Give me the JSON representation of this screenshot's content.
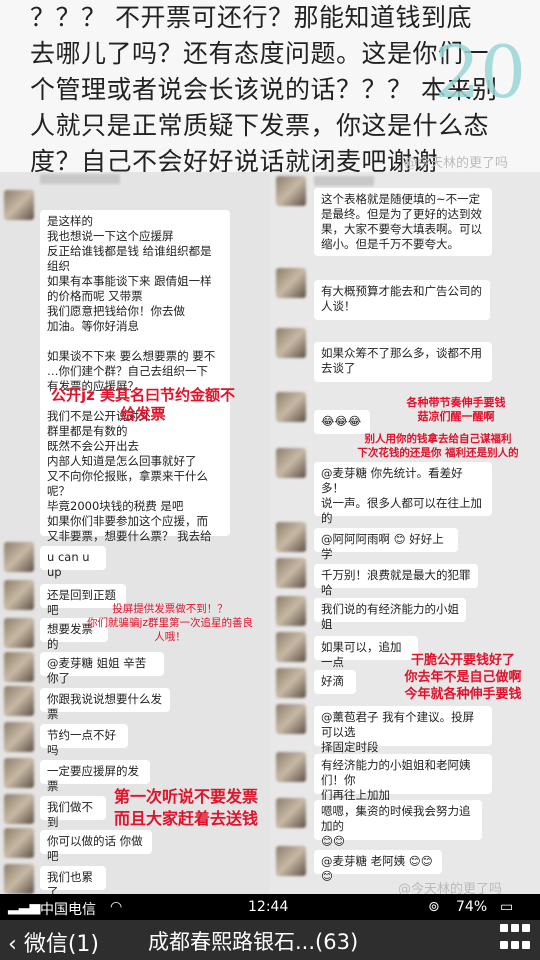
{
  "header": {
    "line1": "？？？ 不开票可还行？那能知道钱到底",
    "line2": "去哪儿了吗？还有态度问题。这是你们一",
    "line3": "个管理或者说会长该说的话？？？ 本来别",
    "line4": "人就只是正常质疑下发票，你这是什么态",
    "line5": "度？自己不会好好说话就闭麦吧谢谢",
    "page_number": "20",
    "watermark": "@今天林的更了吗"
  },
  "left_messages": [
    "是这样的\n我也想说一下这个应援屏\n反正给谁钱都是钱 给谁组织都是\n组织\n如果有本事能谈下来 跟倩姐一样\n的价格而呢 又带票\n我们愿意把钱给你！你去做\n加油。等你好消息\n\n如果谈不下来 要么想要票的 要不\n…你们建个群？自己去组织一下\n有发票的应援屏？\n\n我们不是公开说对外\n群里都是有数的\n既然不会公开出去\n内部人知道是怎么回事就好了\n又不向你伦报账，拿票来干什么\n呢？\n毕竟2000块钱的税费 是吧\n如果你们非要参加这个应援，而\n又非要票，想要什么票？ 我去给",
    "u can u up",
    "还是回到正题吧",
    "想要发票的",
    "@麦芽糖 姐姐 辛苦你了",
    "你跟我说说想要什么发票",
    "节约一点不好吗",
    "一定要应援屏的发票",
    "我们做不到",
    "你可以做的话 你做吧",
    "我们也累了"
  ],
  "right_messages": [
    "这个表格就是随便填的~不一定\n是最终。但是为了更好的达到效\n果，大家不要夸大填表啊。可以\n缩小。但是千万不要夸大。",
    "有大概预算才能去和广告公司的\n人谈！",
    "如果众筹不了那么多，谈都不用\n去谈了",
    "😂😂😂",
    "@麦芽糖 你先统计。看差好多！\n说一声。很多人都可以在往上加\n的",
    "@阿阿阿雨啊 😊 好好上学",
    "千万别！浪费就是最大的犯罪哈",
    "我们说的有经济能力的小姐姐",
    "如果可以，追加一点",
    "好滴",
    "@薰苞君子 我有个建议。投屏可以选\n择固定时段",
    "有经济能力的小姐姐和老阿姨们！你\n们再往上加加",
    "嗯嗯，集资的时候我会努力追加的\n😊😊",
    "@麦芽糖 老阿姨 😊😊😊"
  ],
  "annotations": {
    "left_1": "公开jz 美其名曰节约金额不\n给发票",
    "left_2": "投屏提供发票做不到！？\n你们就骗骗jz群里第一次追星的善良\n人哦！",
    "left_3": "第一次听说不要发票\n而且大家赶着去送钱",
    "right_1": "各种带节奏伸手要钱\n菇凉们醒一醒啊",
    "right_2": "别人用你的钱拿去给自己谋福利\n下次花钱的还是你 福利还是别人的",
    "right_3": "干脆公开要钱好了\n你去年不是自己做啊\n今年就各种伸手要钱"
  },
  "status_bar": {
    "carrier": "中国电信",
    "time": "12:44",
    "battery": "74%"
  },
  "nav": {
    "back_label": "微信(1)",
    "title": "成都春熙路银石...(63)"
  },
  "colors": {
    "annotation_red": "#e2122b",
    "navbar_bg": "#2e2e2e",
    "watermark_cyan": "#9ad6d6"
  }
}
